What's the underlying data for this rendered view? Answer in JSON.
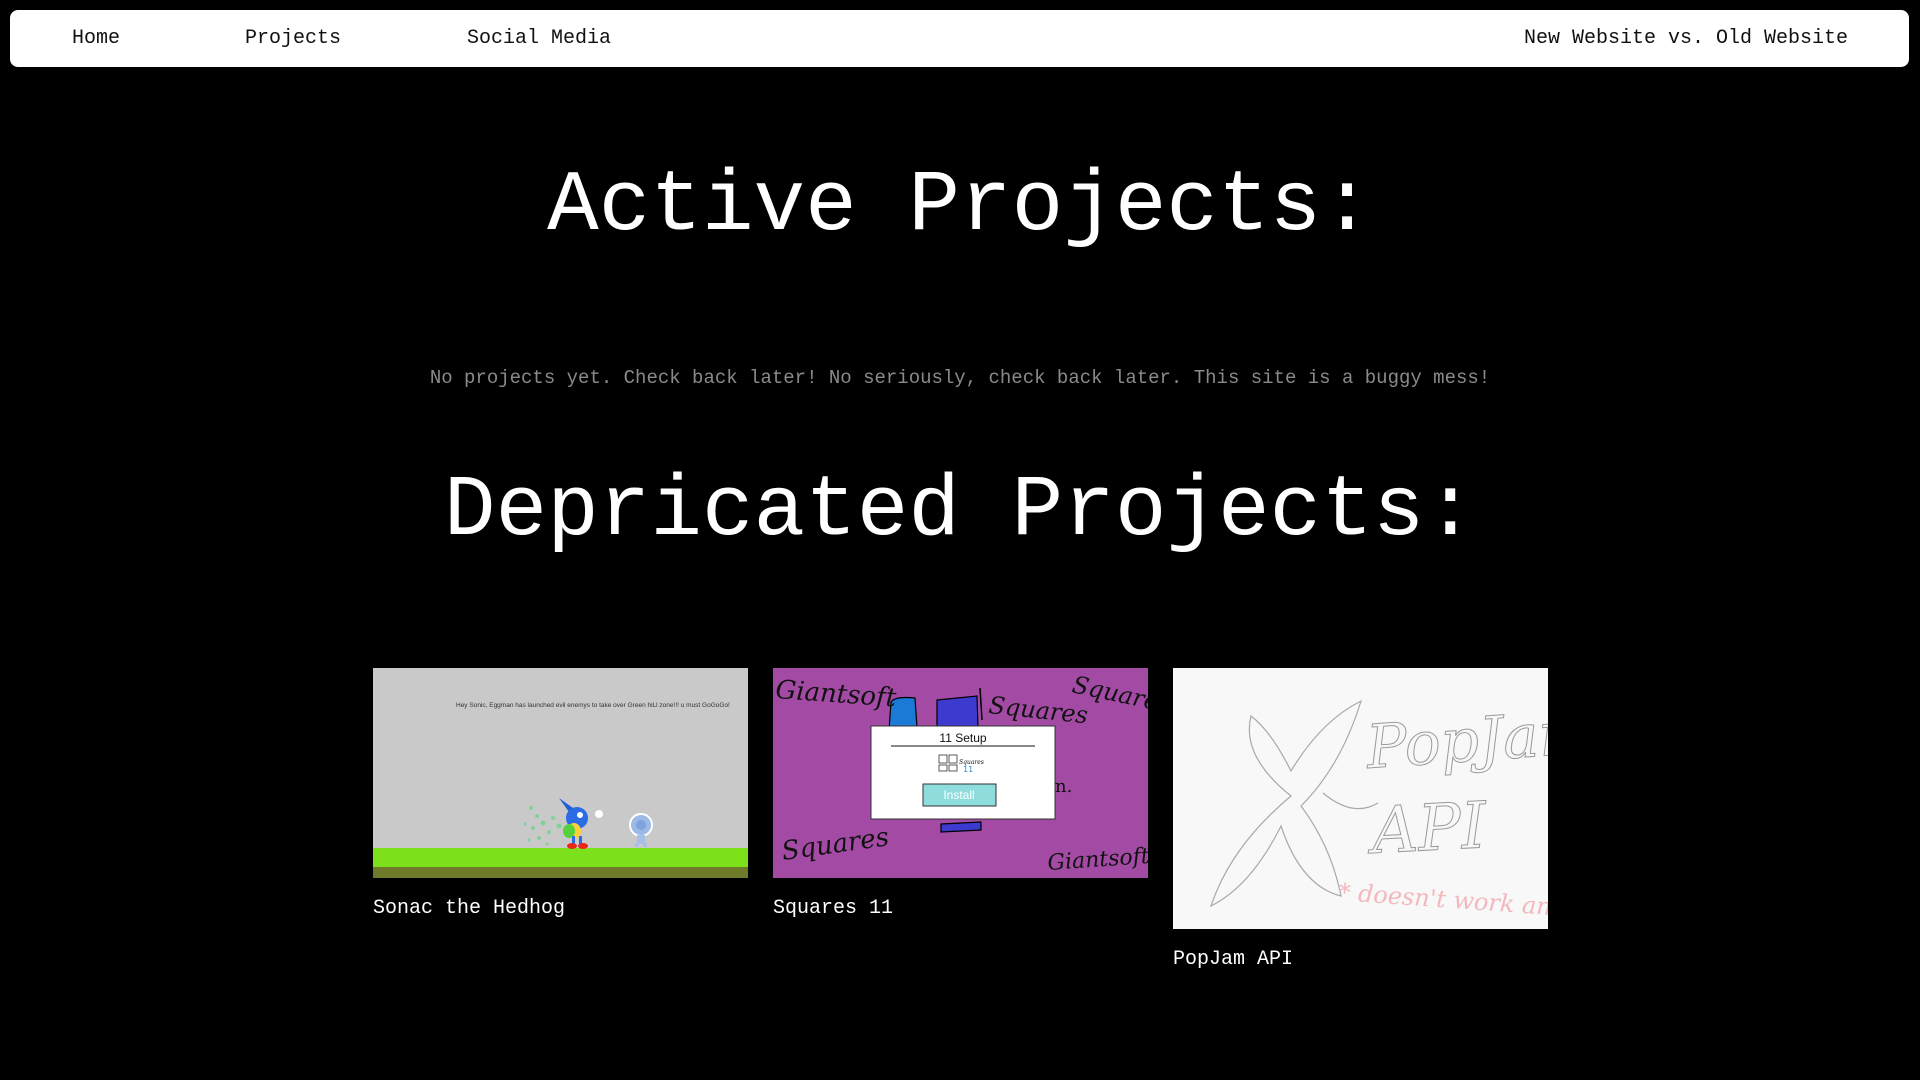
{
  "nav": {
    "home": "Home",
    "projects": "Projects",
    "social": "Social Media",
    "compare": "New Website vs. Old Website"
  },
  "active": {
    "heading": "Active Projects:",
    "notice": "No projects yet. Check back later! No seriously, check back later. This site is a buggy mess!"
  },
  "deprecated": {
    "heading": "Depricated Projects:",
    "projects": [
      {
        "title": "Sonac the Hedhog",
        "thumb_text": "Hey Sonic, Eggman has launched evil enemys to take over Green hiLl zone!!! u must GoGoGo!"
      },
      {
        "title": "Squares 11",
        "thumb_dialog_title": "11 Setup",
        "thumb_install": "Install",
        "thumb_scribble_brand": "Giantsoft",
        "thumb_scribble_name": "Squares",
        "thumb_logo_text": "Squares",
        "thumb_logo_num": "11"
      },
      {
        "title": "PopJam API",
        "thumb_scribble_name": "PopJam",
        "thumb_scribble_api": "API",
        "thumb_note": "* doesn't work anymore"
      }
    ]
  },
  "colors": {
    "page_bg": "#000000",
    "nav_bg": "#ffffff",
    "notice_text": "#8a8a8a",
    "squares_thumb_bg": "#a24aa4",
    "squares_install_bg": "#8fdcdc",
    "sonac_grass": "#7ce11a"
  }
}
